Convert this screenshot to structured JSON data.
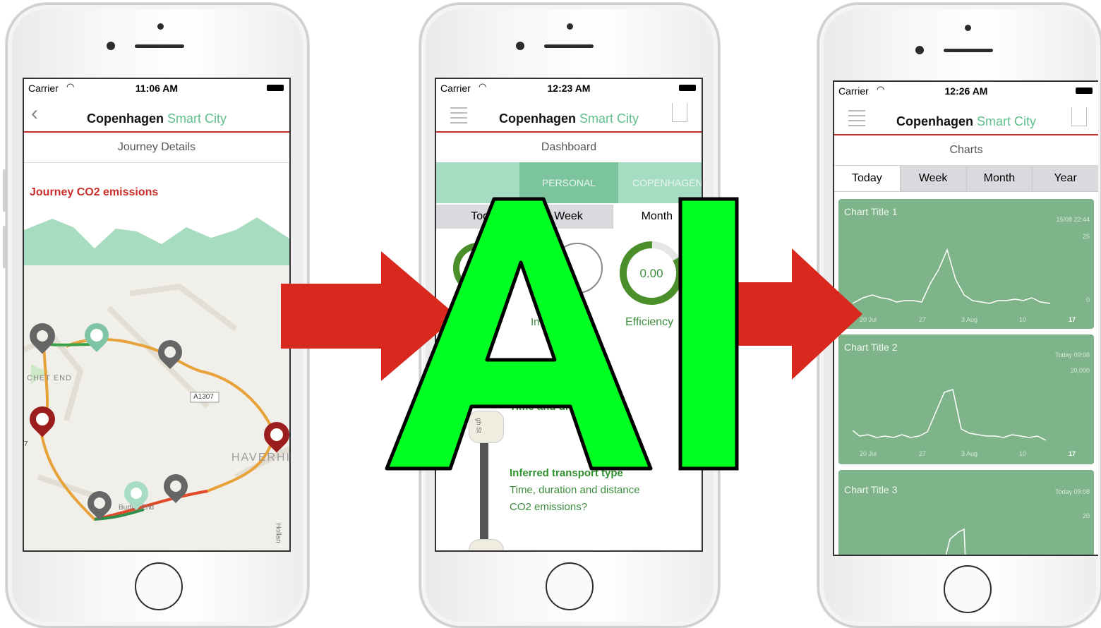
{
  "phones": [
    {
      "status": {
        "carrier": "Carrier",
        "time": "11:06 AM"
      },
      "nav": {
        "title_main": "Copenhagen",
        "title_accent": "Smart City",
        "back_icon": "chevron-left-icon"
      },
      "subtitle": "Journey Details",
      "section_title": "Journey CO2 emissions",
      "map": {
        "labels": [
          "CHET END",
          "A1307",
          "HAVERHI",
          "7",
          "Burton End",
          "Hollan"
        ]
      }
    },
    {
      "status": {
        "carrier": "Carrier",
        "time": "12:23 AM"
      },
      "nav": {
        "title_main": "Copenhagen",
        "title_accent": "Smart City",
        "menu_icon": "hamburger-icon",
        "share_icon": "share-icon"
      },
      "subtitle": "Dashboard",
      "tabs": [
        "PERSONAL",
        "COPENHAGEN"
      ],
      "periods": [
        "Tod",
        "Week",
        "Month"
      ],
      "gauges": [
        {
          "label": "l",
          "value": ""
        },
        {
          "label": "In ts",
          "value": ""
        },
        {
          "label": "Efficiency",
          "value": "0.00"
        }
      ],
      "timeline": {
        "street": "gh St",
        "partial_text": "Time and di",
        "entry_title": "Inferred transport type",
        "entry_line1": "Time, duration and distance",
        "entry_line2": "CO2 emissions?"
      }
    },
    {
      "status": {
        "carrier": "Carrier",
        "time": "12:26 AM"
      },
      "nav": {
        "title_main": "Copenhagen",
        "title_accent": "Smart City",
        "menu_icon": "hamburger-icon",
        "share_icon": "share-icon"
      },
      "subtitle": "Charts",
      "periods": [
        "Today",
        "Week",
        "Month",
        "Year"
      ],
      "cards": [
        {
          "title": "Chart Title 1",
          "date": "15/08 22:44",
          "ymax": "25",
          "ymin": "0",
          "xticks": [
            "20 Jul",
            "27",
            "3 Aug",
            "10",
            "17"
          ]
        },
        {
          "title": "Chart Title 2",
          "date": "Today 09:08",
          "ymax": "20,000",
          "ymin": "",
          "xticks": [
            "20 Jul",
            "27",
            "3 Aug",
            "10",
            "17"
          ]
        },
        {
          "title": "Chart Title 3",
          "date": "Today 09:08",
          "ymax": "20",
          "ymin": "",
          "xticks": []
        }
      ]
    }
  ],
  "overlay": {
    "text": "AI",
    "color": "#00ff22"
  },
  "colors": {
    "accent_green": "#5fbf8d",
    "nav_red": "#c9302c",
    "arrow_red": "#d9281e",
    "card_green": "#7fb48a"
  }
}
